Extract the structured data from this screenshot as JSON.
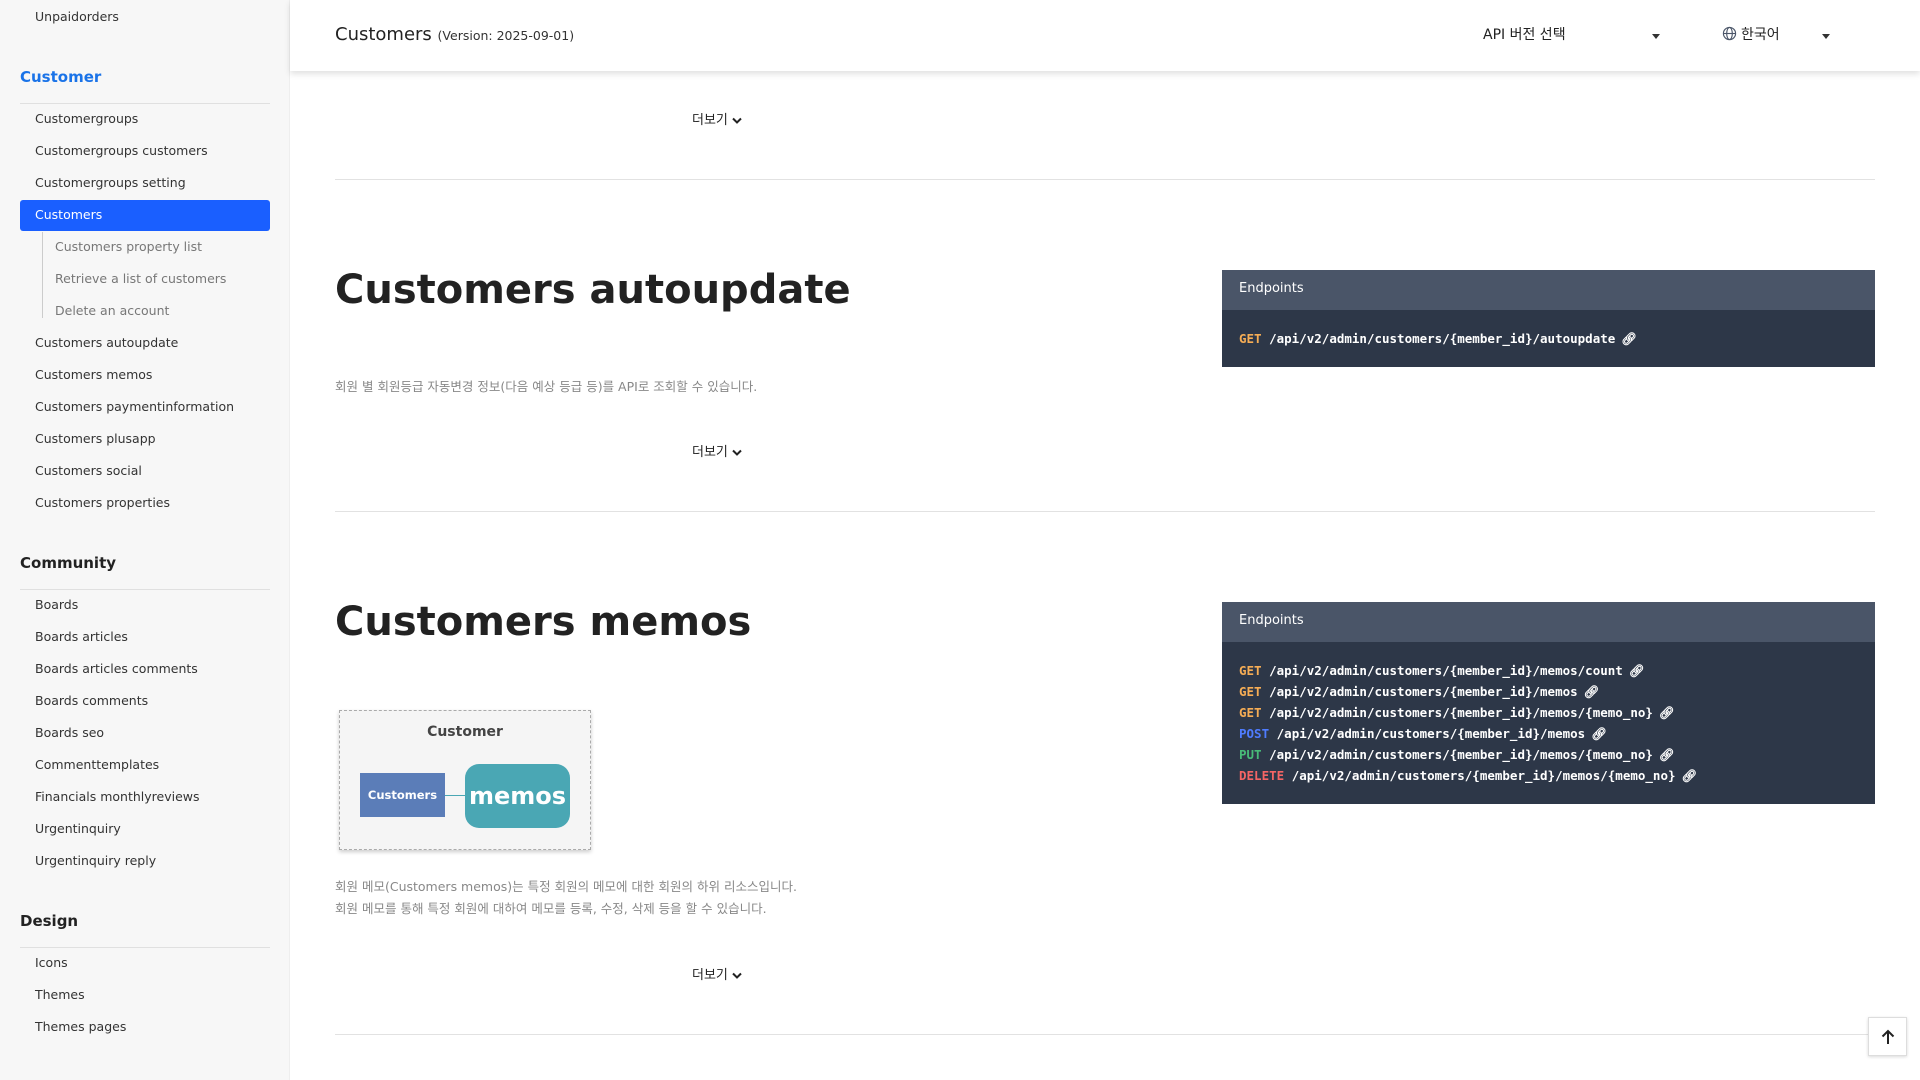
{
  "sidebar": {
    "top_item": "Unpaidorders",
    "customer_section": "Customer",
    "customer_items": [
      "Customergroups",
      "Customergroups customers",
      "Customergroups setting",
      "Customers",
      "Customers autoupdate",
      "Customers memos",
      "Customers paymentinformation",
      "Customers plusapp",
      "Customers social",
      "Customers properties"
    ],
    "customers_sub": [
      "Customers property list",
      "Retrieve a list of customers",
      "Delete an account"
    ],
    "community_section": "Community",
    "community_items": [
      "Boards",
      "Boards articles",
      "Boards articles comments",
      "Boards comments",
      "Boards seo",
      "Commenttemplates",
      "Financials monthlyreviews",
      "Urgentinquiry",
      "Urgentinquiry reply"
    ],
    "design_section": "Design",
    "design_items": [
      "Icons",
      "Themes",
      "Themes pages"
    ]
  },
  "header": {
    "title": "Customers",
    "version": "(Version: 2025-09-01)",
    "api_select": "API 버전 선택",
    "language": "한국어"
  },
  "more_label": "더보기",
  "sections": [
    {
      "title": "Customers autoupdate",
      "description": [
        "회원 별 회원등급 자동변경 정보(다음 예상 등급 등)를 API로 조회할 수 있습니다."
      ],
      "endpoints_title": "Endpoints",
      "endpoints": [
        {
          "method": "GET",
          "path": "/api/v2/admin/customers/{member_id}/autoupdate"
        }
      ]
    },
    {
      "title": "Customers memos",
      "description": [
        "회원 메모(Customers memos)는 특정 회원의 메모에 대한 회원의 하위 리소스입니다.",
        "회원 메모를 통해 특정 회원에 대하여 메모를 등록, 수정, 삭제 등을 할 수 있습니다."
      ],
      "endpoints_title": "Endpoints",
      "endpoints": [
        {
          "method": "GET",
          "path": "/api/v2/admin/customers/{member_id}/memos/count"
        },
        {
          "method": "GET",
          "path": "/api/v2/admin/customers/{member_id}/memos"
        },
        {
          "method": "GET",
          "path": "/api/v2/admin/customers/{member_id}/memos/{memo_no}"
        },
        {
          "method": "POST",
          "path": "/api/v2/admin/customers/{member_id}/memos"
        },
        {
          "method": "PUT",
          "path": "/api/v2/admin/customers/{member_id}/memos/{memo_no}"
        },
        {
          "method": "DELETE",
          "path": "/api/v2/admin/customers/{member_id}/memos/{memo_no}"
        }
      ],
      "diagram": {
        "title": "Customer",
        "parent": "Customers",
        "child": "memos"
      }
    }
  ],
  "colors": {
    "accent": "#1a5fff",
    "endpoint_bg": "#2d3748",
    "get": "#f6ad55",
    "post": "#4f7cff",
    "put": "#48bb78",
    "delete": "#f56565"
  }
}
